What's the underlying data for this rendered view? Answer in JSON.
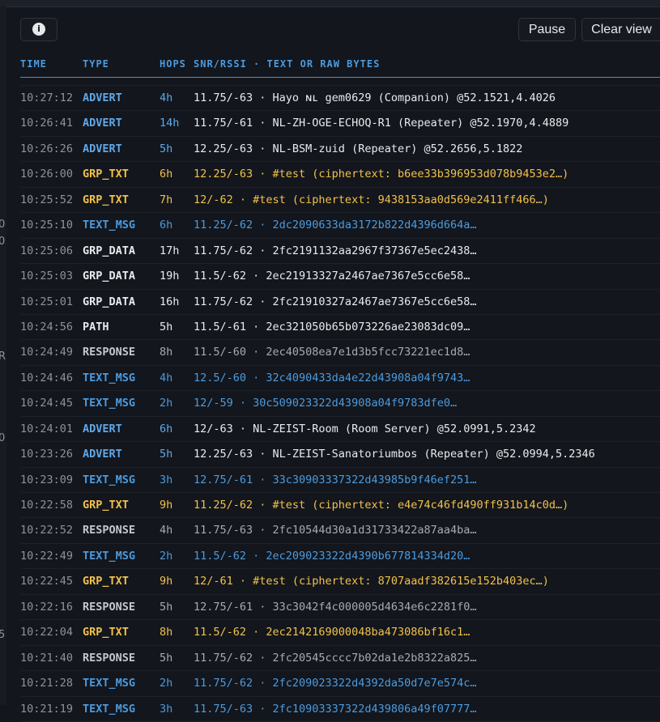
{
  "toolbar": {
    "pause_label": "Pause",
    "clear_label": "Clear view",
    "info_glyph": "i"
  },
  "columns": {
    "time": "TIME",
    "type": "TYPE",
    "hops": "HOPS",
    "details": "SNR/RSSI · TEXT OR RAW BYTES"
  },
  "left_glimpses": [
    "0",
    "0",
    "R",
    "0",
    "5"
  ],
  "rows": [
    {
      "time": "10:27:12",
      "type": "ADVERT",
      "hops": "4h",
      "details": "11.75/-63 · Hayo ɴʟ gem0629 (Companion) @52.1521,4.4026"
    },
    {
      "time": "10:26:41",
      "type": "ADVERT",
      "hops": "14h",
      "details": "11.75/-61 · NL-ZH-OGE-ECHOQ-R1 (Repeater) @52.1970,4.4889"
    },
    {
      "time": "10:26:26",
      "type": "ADVERT",
      "hops": "5h",
      "details": "12.25/-63 · NL-BSM-zuid (Repeater) @52.2656,5.1822"
    },
    {
      "time": "10:26:00",
      "type": "GRP_TXT",
      "hops": "6h",
      "details": "12.25/-63 · #test (ciphertext: b6ee33b396953d078b9453e2…)"
    },
    {
      "time": "10:25:52",
      "type": "GRP_TXT",
      "hops": "7h",
      "details": "12/-62 · #test (ciphertext: 9438153aa0d569e2411ff466…)"
    },
    {
      "time": "10:25:10",
      "type": "TEXT_MSG",
      "hops": "6h",
      "details": "11.25/-62 · 2dc2090633da3172b822d4396d664a…"
    },
    {
      "time": "10:25:06",
      "type": "GRP_DATA",
      "hops": "17h",
      "details": "11.75/-62 · 2fc2191132aa2967f37367e5ec2438…"
    },
    {
      "time": "10:25:03",
      "type": "GRP_DATA",
      "hops": "19h",
      "details": "11.5/-62 · 2ec21913327a2467ae7367e5cc6e58…"
    },
    {
      "time": "10:25:01",
      "type": "GRP_DATA",
      "hops": "16h",
      "details": "11.75/-62 · 2fc21910327a2467ae7367e5cc6e58…"
    },
    {
      "time": "10:24:56",
      "type": "PATH",
      "hops": "5h",
      "details": "11.5/-61 · 2ec321050b65b073226ae23083dc09…"
    },
    {
      "time": "10:24:49",
      "type": "RESPONSE",
      "hops": "8h",
      "details": "11.5/-60 · 2ec40508ea7e1d3b5fcc73221ec1d8…"
    },
    {
      "time": "10:24:46",
      "type": "TEXT_MSG",
      "hops": "4h",
      "details": "12.5/-60 · 32c4090433da4e22d43908a04f9743…"
    },
    {
      "time": "10:24:45",
      "type": "TEXT_MSG",
      "hops": "2h",
      "details": "12/-59 · 30c509023322d43908a04f9783dfe0…"
    },
    {
      "time": "10:24:01",
      "type": "ADVERT",
      "hops": "6h",
      "details": "12/-63 · NL-ZEIST-Room (Room Server) @52.0991,5.2342"
    },
    {
      "time": "10:23:26",
      "type": "ADVERT",
      "hops": "5h",
      "details": "12.25/-63 · NL-ZEIST-Sanatoriumbos (Repeater) @52.0994,5.2346"
    },
    {
      "time": "10:23:09",
      "type": "TEXT_MSG",
      "hops": "3h",
      "details": "12.75/-61 · 33c30903337322d43985b9f46ef251…"
    },
    {
      "time": "10:22:58",
      "type": "GRP_TXT",
      "hops": "9h",
      "details": "11.25/-62 · #test (ciphertext: e4e74c46fd490ff931b14c0d…)"
    },
    {
      "time": "10:22:52",
      "type": "RESPONSE",
      "hops": "4h",
      "details": "11.75/-63 · 2fc10544d30a1d31733422a87aa4ba…"
    },
    {
      "time": "10:22:49",
      "type": "TEXT_MSG",
      "hops": "2h",
      "details": "11.5/-62 · 2ec209023322d4390b677814334d20…"
    },
    {
      "time": "10:22:45",
      "type": "GRP_TXT",
      "hops": "9h",
      "details": "12/-61 · #test (ciphertext: 8707aadf382615e152b403ec…)"
    },
    {
      "time": "10:22:16",
      "type": "RESPONSE",
      "hops": "5h",
      "details": "12.75/-61 · 33c3042f4c000005d4634e6c2281f0…"
    },
    {
      "time": "10:22:04",
      "type": "GRP_TXT",
      "hops": "8h",
      "details": "11.5/-62 · 2ec2142169000048ba473086bf16c1…"
    },
    {
      "time": "10:21:40",
      "type": "RESPONSE",
      "hops": "5h",
      "details": "11.75/-62 · 2fc20545cccc7b02da1e2b8322a825…"
    },
    {
      "time": "10:21:28",
      "type": "TEXT_MSG",
      "hops": "2h",
      "details": "11.75/-62 · 2fc209023322d4392da50d7e7e574c…"
    },
    {
      "time": "10:21:19",
      "type": "TEXT_MSG",
      "hops": "3h",
      "details": "11.75/-63 · 2fc10903337322d439806a49f07777…"
    }
  ]
}
